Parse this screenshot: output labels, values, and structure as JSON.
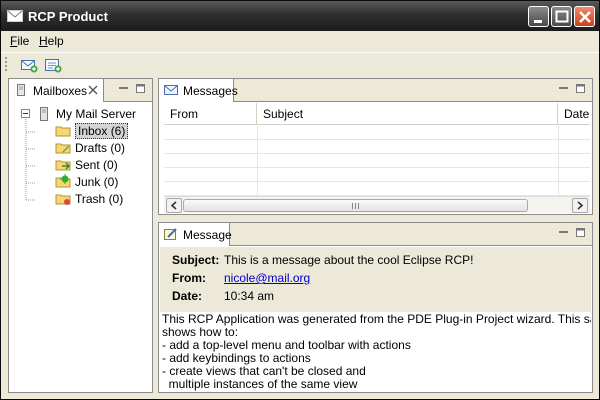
{
  "window": {
    "title": "RCP Product",
    "icon": "mail-app-icon",
    "controls": [
      "minimize-icon",
      "maximize-icon",
      "close-icon"
    ]
  },
  "menubar": {
    "file": {
      "accel": "F",
      "rest": "ile"
    },
    "help": {
      "accel": "H",
      "rest": "elp"
    }
  },
  "toolbar": {
    "buttons": [
      "open-mailbox-icon",
      "open-message-icon"
    ]
  },
  "mailboxes_view": {
    "tab_label": "Mailboxes",
    "tree": {
      "root": "My Mail Server",
      "children": [
        {
          "label": "Inbox (6)",
          "icon": "folder-icon",
          "selected": true
        },
        {
          "label": "Drafts (0)",
          "icon": "drafts-folder-icon"
        },
        {
          "label": "Sent (0)",
          "icon": "sent-folder-icon"
        },
        {
          "label": "Junk (0)",
          "icon": "junk-folder-icon"
        },
        {
          "label": "Trash (0)",
          "icon": "trash-folder-icon"
        }
      ]
    }
  },
  "messages_view": {
    "tab_label": "Messages",
    "columns": [
      "From",
      "Subject",
      "Date"
    ]
  },
  "message_view": {
    "tab_label": "Message",
    "subject_label": "Subject:",
    "subject": "This is a message about the cool Eclipse RCP!",
    "from_label": "From:",
    "from": "nicole@mail.org",
    "date_label": "Date:",
    "date": "10:34 am",
    "body": "This RCP Application was generated from the PDE Plug-in Project wizard. This sample\nshows how to:\n- add a top-level menu and toolbar with actions\n- add keybindings to actions\n- create views that can't be closed and\n  multiple instances of the same view"
  }
}
